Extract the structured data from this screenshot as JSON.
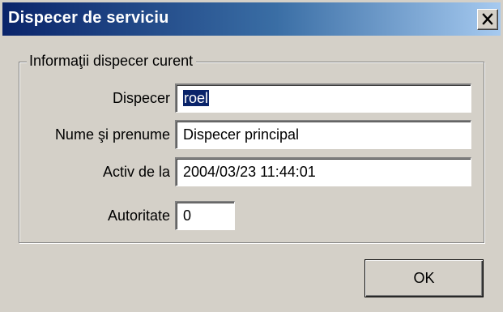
{
  "window": {
    "title": "Dispecer de serviciu"
  },
  "titlebar": {
    "close_icon": "close-icon",
    "colors": {
      "gradient_start": "#0a246a",
      "gradient_end": "#a6caf0"
    }
  },
  "group": {
    "legend": "Informaţii dispecer curent",
    "fields": [
      {
        "label": "Dispecer",
        "value": "roel"
      },
      {
        "label": "Nume şi prenume",
        "value": "Dispecer principal"
      },
      {
        "label": "Activ de la",
        "value": "2004/03/23 11:44:01"
      },
      {
        "label": "Autoritate",
        "value": "0"
      }
    ]
  },
  "buttons": {
    "ok_label": "OK"
  }
}
